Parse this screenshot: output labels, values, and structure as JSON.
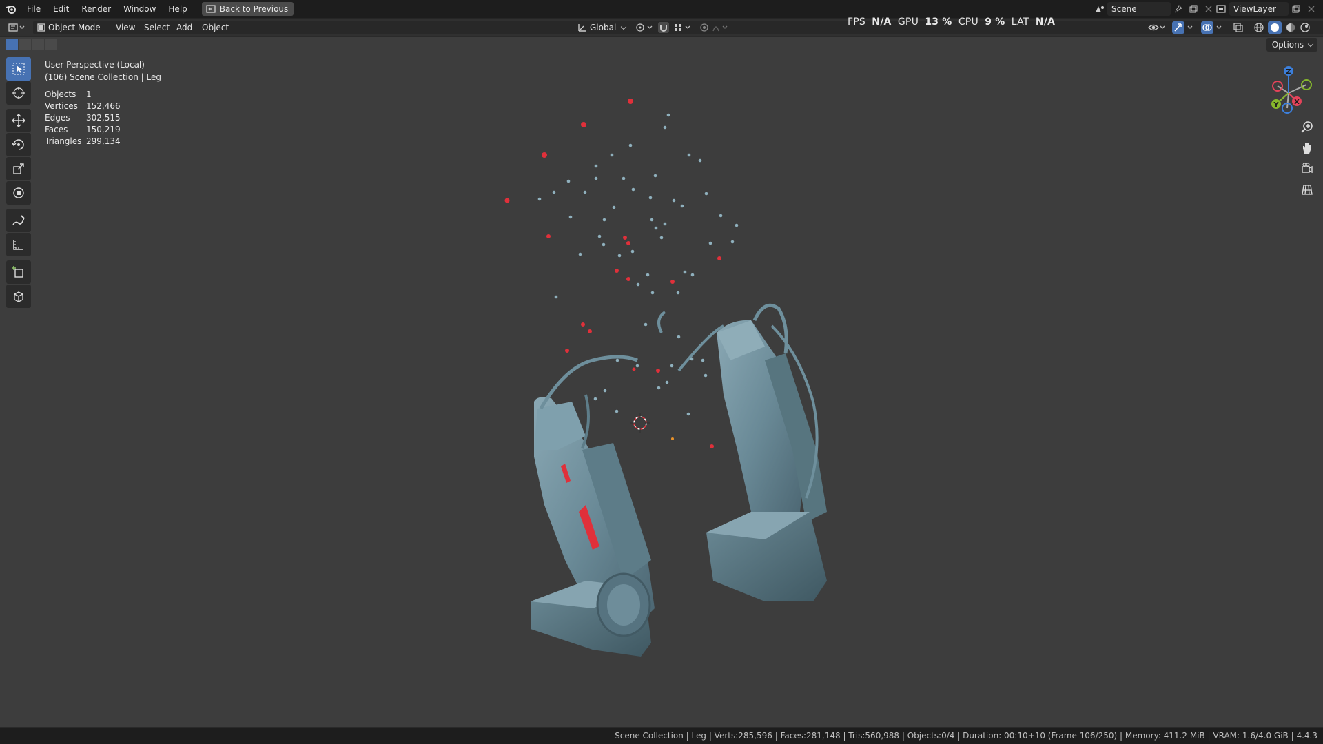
{
  "menu": {
    "items": [
      "File",
      "Edit",
      "Render",
      "Window",
      "Help"
    ],
    "back_button": "Back to Previous"
  },
  "topbar": {
    "scene_name": "Scene",
    "view_layer": "ViewLayer"
  },
  "header": {
    "mode": "Object Mode",
    "menus": [
      "View",
      "Select",
      "Add",
      "Object"
    ],
    "transform_orientation": "Global"
  },
  "perf": {
    "fps_label": "FPS",
    "fps_value": "N/A",
    "gpu_label": "GPU",
    "gpu_value": "13 %",
    "cpu_label": "CPU",
    "cpu_value": "9 %",
    "lat_label": "LAT",
    "lat_value": "N/A"
  },
  "viewport": {
    "perspective": "User Perspective (Local)",
    "collection": "(106) Scene Collection | Leg",
    "options_label": "Options",
    "stats": [
      {
        "label": "Objects",
        "value": "1"
      },
      {
        "label": "Vertices",
        "value": "152,466"
      },
      {
        "label": "Edges",
        "value": "302,515"
      },
      {
        "label": "Faces",
        "value": "150,219"
      },
      {
        "label": "Triangles",
        "value": "299,134"
      }
    ],
    "gizmo_axes": {
      "x": "X",
      "y": "Y",
      "z": "Z"
    }
  },
  "colors": {
    "accent": "#4772b3",
    "mesh": "#6e8f9c",
    "particle_red": "#e0303a",
    "gizmo_x": "#e5435a",
    "gizmo_y": "#86b82c",
    "gizmo_z": "#3c7fdb"
  },
  "statusbar": {
    "text": "Scene Collection | Leg | Verts:285,596 | Faces:281,148 | Tris:560,988 | Objects:0/4 | Duration: 00:10+10 (Frame 106/250) | Memory: 411.2 MiB | VRAM: 1.6/4.0 GiB | 4.4.3"
  }
}
